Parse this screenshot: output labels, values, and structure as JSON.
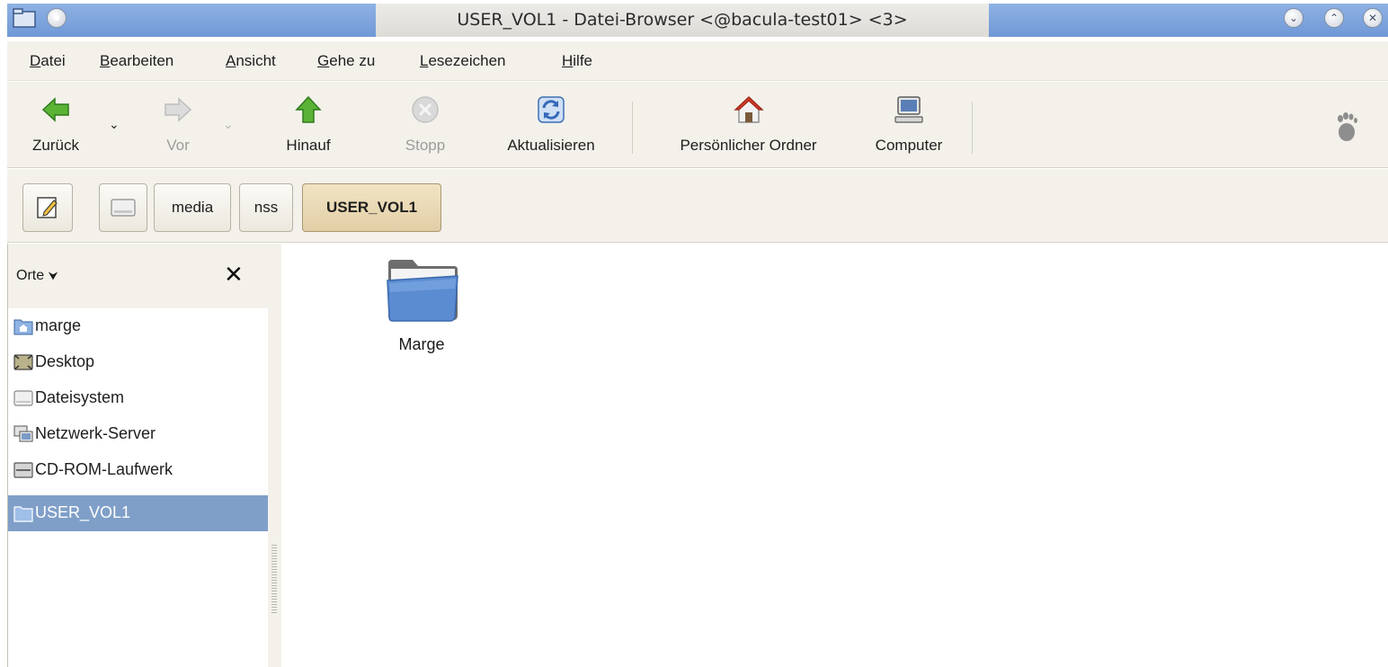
{
  "window": {
    "title": "USER_VOL1 - Datei-Browser <@bacula-test01> <3>",
    "app_icon": "window-icon",
    "controls": [
      "minimize",
      "maximize",
      "close"
    ]
  },
  "menubar": {
    "items": [
      {
        "label": "Datei"
      },
      {
        "label": "Bearbeiten"
      },
      {
        "label": "Ansicht"
      },
      {
        "label": "Gehe zu"
      },
      {
        "label": "Lesezeichen"
      },
      {
        "label": "Hilfe"
      }
    ]
  },
  "toolbar": {
    "back": {
      "label": "Zurück",
      "icon": "back-arrow-icon",
      "enabled": true
    },
    "forward": {
      "label": "Vor",
      "icon": "forward-arrow-icon",
      "enabled": false
    },
    "up": {
      "label": "Hinauf",
      "icon": "up-arrow-icon",
      "enabled": true
    },
    "stop": {
      "label": "Stopp",
      "icon": "stop-icon",
      "enabled": false
    },
    "reload": {
      "label": "Aktualisieren",
      "icon": "refresh-icon",
      "enabled": true
    },
    "home": {
      "label": "Persönlicher Ordner",
      "icon": "home-icon",
      "enabled": true
    },
    "computer": {
      "label": "Computer",
      "icon": "computer-icon",
      "enabled": true
    },
    "logo": "gnome-foot-icon"
  },
  "pathbar": {
    "items": [
      {
        "label": "",
        "icon": "drive-icon"
      },
      {
        "label": "media"
      },
      {
        "label": "nss"
      },
      {
        "label": "USER_VOL1",
        "active": true
      }
    ]
  },
  "sidebar": {
    "title": "Orte",
    "places": [
      {
        "label": "marge",
        "icon": "home-folder-icon"
      },
      {
        "label": "Desktop",
        "icon": "desktop-icon"
      },
      {
        "label": "Dateisystem",
        "icon": "drive-icon"
      },
      {
        "label": "Netzwerk-Server",
        "icon": "network-server-icon"
      },
      {
        "label": "CD-ROM-Laufwerk",
        "icon": "cdrom-icon"
      },
      {
        "label": "USER_VOL1",
        "icon": "folder-icon",
        "selected": true
      }
    ]
  },
  "files": [
    {
      "name": "Marge",
      "icon": "folder-icon"
    }
  ],
  "colors": {
    "titlebar_accent": "#7fa4dc",
    "selection": "#7f9fc8",
    "active_path": "#e8d6b0"
  }
}
